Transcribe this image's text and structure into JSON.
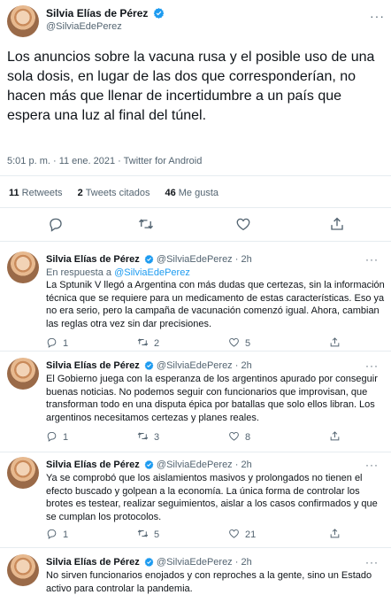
{
  "author": {
    "name": "Silvia Elías de Pérez",
    "handle": "@SilviaEdePerez"
  },
  "main_tweet": {
    "text": "Los anuncios sobre la vacuna rusa y el posible uso de una sola dosis, en lugar de las dos que corresponderían, no hacen más que llenar de incertidumbre a un país que espera una luz al final del túnel.",
    "meta": "5:01 p. m. · 11 ene. 2021 · Twitter for Android",
    "stats": {
      "retweets_count": "11",
      "retweets_label": "Retweets",
      "quotes_count": "2",
      "quotes_label": "Tweets citados",
      "likes_count": "46",
      "likes_label": "Me gusta"
    }
  },
  "replies": [
    {
      "name": "Silvia Elías de Pérez",
      "handle": "@SilviaEdePerez · 2h",
      "in_reply_prefix": "En respuesta a",
      "in_reply_to": "@SilviaEdePerez",
      "text": "La Sptunik V llegó a Argentina con más dudas que certezas, sin la información técnica que se requiere para un medicamento de estas características. Eso ya no era serio, pero la campaña de vacunación comenzó igual. Ahora, cambian las reglas otra vez sin dar precisiones.",
      "replies": "1",
      "retweets": "2",
      "likes": "5"
    },
    {
      "name": "Silvia Elías de Pérez",
      "handle": "@SilviaEdePerez · 2h",
      "text": "El Gobierno juega con la esperanza de los argentinos apurado por conseguir buenas noticias. No podemos seguir con funcionarios que improvisan, que transforman todo en una disputa épica por batallas que solo ellos libran. Los argentinos necesitamos certezas y planes reales.",
      "replies": "1",
      "retweets": "3",
      "likes": "8"
    },
    {
      "name": "Silvia Elías de Pérez",
      "handle": "@SilviaEdePerez · 2h",
      "text": "Ya se comprobó que los aislamientos masivos y prolongados no tienen el efecto buscado y golpean a la economía. La única forma de controlar los brotes es testear, realizar seguimientos, aislar a los casos confirmados y que se cumplan los protocolos.",
      "replies": "1",
      "retweets": "5",
      "likes": "21"
    },
    {
      "name": "Silvia Elías de Pérez",
      "handle": "@SilviaEdePerez · 2h",
      "text": "No sirven funcionarios enojados y con reproches a la gente, sino un Estado activo para controlar la pandemia."
    }
  ],
  "colors": {
    "link": "#1d9bf0",
    "muted": "#536471",
    "verified": "#1d9bf0",
    "divider": "#e6ecf0"
  },
  "icons": [
    "verified-badge-icon",
    "more-icon",
    "reply-icon",
    "retweet-icon",
    "like-icon",
    "share-icon"
  ]
}
